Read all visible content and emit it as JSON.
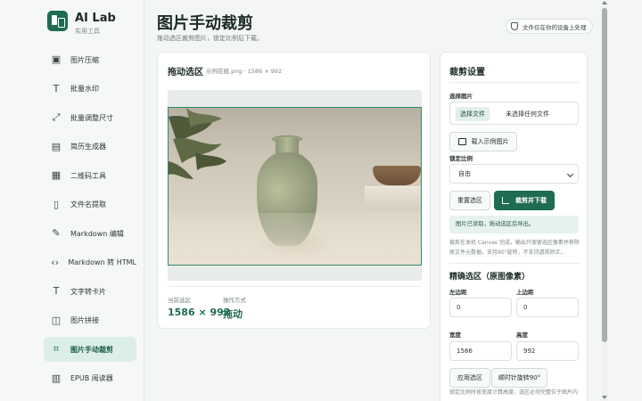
{
  "brand": {
    "title": "AI Lab",
    "subtitle": "实用工具"
  },
  "sidebar": {
    "items": [
      {
        "label": "图片压缩",
        "icon": "image-icon"
      },
      {
        "label": "批量水印",
        "icon": "text-t-icon"
      },
      {
        "label": "批量调整尺寸",
        "icon": "resize-icon"
      },
      {
        "label": "简历生成器",
        "icon": "document-icon"
      },
      {
        "label": "二维码工具",
        "icon": "qrcode-icon"
      },
      {
        "label": "文件名提取",
        "icon": "file-icon"
      },
      {
        "label": "Markdown 编辑",
        "icon": "pen-icon"
      },
      {
        "label": "Markdown 转 HTML",
        "icon": "code-icon"
      },
      {
        "label": "文字转卡片",
        "icon": "text-t-icon"
      },
      {
        "label": "图片拼接",
        "icon": "columns-icon"
      },
      {
        "label": "图片手动裁剪",
        "icon": "crop-icon",
        "active": true
      },
      {
        "label": "EPUB 阅读器",
        "icon": "book-icon"
      }
    ]
  },
  "header": {
    "title": "图片手动裁剪",
    "subtitle": "拖动选区裁剪图片，锁定比例后下载。",
    "privacy_badge": "文件仅在你的设备上处理"
  },
  "preview": {
    "title": "拖动选区",
    "file_info": "示例花瓶.png · 1586 × 992",
    "current_selection_label": "当前选区",
    "current_selection_value": "1586 × 992",
    "operation_label": "操作方式",
    "operation_value": "拖动"
  },
  "settings": {
    "title": "裁剪设置",
    "choose_image_label": "选择图片",
    "choose_file_button": "选择文件",
    "no_file_text": "未选择任何文件",
    "load_sample_button": "载入示例图片",
    "lock_ratio_label": "锁定比例",
    "ratio_selected": "自由",
    "reset_button": "重置选区",
    "crop_download_button": "裁剪并下载",
    "status_text": "图片已读取，拖动选区后导出。",
    "note_text": "裁剪在本机 Canvas 完成，输出只保留选区像素并移除原文件元数据。支持90°旋转，不支持透视矫正。",
    "precise_title": "精确选区（原图像素）",
    "left_label": "左边距",
    "left_value": "0",
    "top_label": "上边距",
    "top_value": "0",
    "width_label": "宽度",
    "width_value": "1586",
    "height_label": "高度",
    "height_value": "992",
    "apply_button": "应用选区",
    "rotate_button": "顺时针旋转90°",
    "hint_text": "锁定比例时按宽度计算高度，选区必须完整位于图片内"
  },
  "colors": {
    "accent": "#1f6b53",
    "active_bg": "#dcefe6"
  }
}
